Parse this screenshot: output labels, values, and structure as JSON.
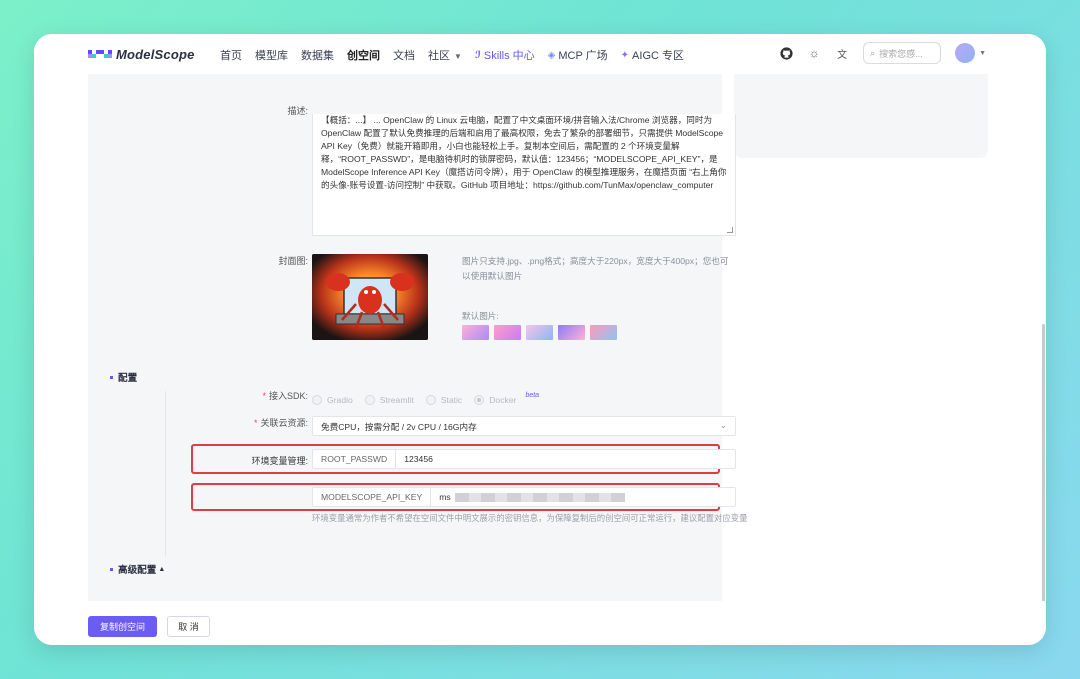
{
  "logo": {
    "text": "ModelScope"
  },
  "nav": {
    "items": [
      "首页",
      "模型库",
      "数据集",
      "创空间",
      "文档",
      "社区"
    ],
    "ai_items": [
      "Skills 中心",
      "MCP 广场",
      "AIGC 专区"
    ],
    "search_placeholder": "搜索您感..."
  },
  "form": {
    "description_label": "描述:",
    "description_text": "【概括：...】 ... OpenClaw 的 Linux 云电脑，配置了中文桌面环境/拼音输入法/Chrome 浏览器，同时为 OpenClaw 配置了默认免费推理的后端和启用了最高权限，免去了繁杂的部署细节，只需提供 ModelScope API Key（免费）就能开箱即用，小白也能轻松上手。复制本空间后，需配置的 2 个环境变量解释，“ROOT_PASSWD”，是电脑待机时的锁屏密码，默认值：123456；“MODELSCOPE_API_KEY”，是 ModelScope Inference API Key（魔搭访问令牌），用于 OpenClaw 的模型推理服务，在魔搭页面 “右上角你的头像-账号设置-访问控制” 中获取。GitHub 项目地址：https://github.com/TunMax/openclaw_computer",
    "cover_label": "封面图:",
    "cover_hint": "图片只支持.jpg、.png格式；高度大于220px，宽度大于400px；您也可以使用默认图片",
    "default_images_label": "默认图片:",
    "config_section": "配置",
    "sdk_label": "接入SDK:",
    "sdk_options": [
      "Gradio",
      "Streamlit",
      "Static",
      "Docker"
    ],
    "sdk_selected": "Docker",
    "beta_tag": "beta",
    "resource_label": "关联云资源:",
    "resource_value": "免费CPU，按需分配 / 2v CPU / 16G内存",
    "env_label": "环境变量管理:",
    "env_vars": [
      {
        "key": "ROOT_PASSWD",
        "value": "123456"
      },
      {
        "key": "MODELSCOPE_API_KEY",
        "value": "ms"
      }
    ],
    "env_note": "环境变量通常为作者不希望在空间文件中明文展示的密钥信息，为保障复制后的创空间可正常运行，建议配置对应变量",
    "advanced_section": "高级配置"
  },
  "buttons": {
    "copy": "复制创空间",
    "cancel": "取 消"
  },
  "colors": {
    "accent": "#6c5cf6",
    "highlight": "#e03b47"
  }
}
